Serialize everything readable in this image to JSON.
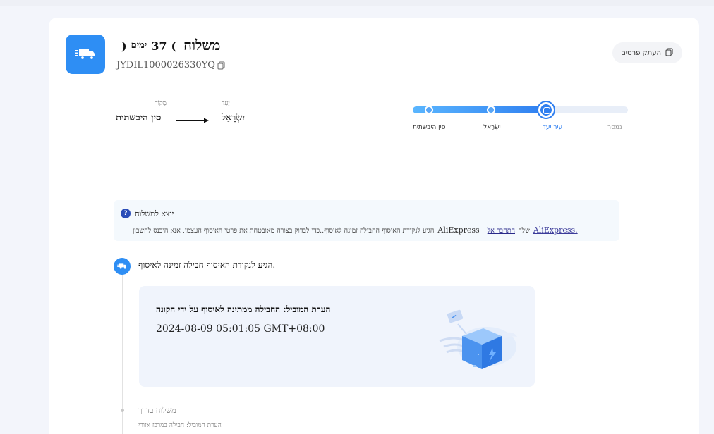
{
  "header": {
    "title": "משלוח",
    "days_number": "37",
    "days_word": "ימים",
    "open_paren": "(",
    "close_paren": ")",
    "tracking_number": "JYDIL1000026330YQ",
    "copy_details_label": "העתק פרטים",
    "icons": {
      "main": "truck-icon",
      "copy": "copy-icon",
      "copy_small": "copy-icon"
    }
  },
  "route": {
    "origin_label": "מָקוֹר",
    "origin_value": "סין היבשתית",
    "destination_label": "יַעַד",
    "destination_value": "יִשְׂרָאֵל"
  },
  "progress": {
    "fraction_filled": 0.62,
    "stages": [
      {
        "label": "סין היבשתית",
        "status": "done"
      },
      {
        "label": "יִשְׂרָאֵל",
        "status": "done"
      },
      {
        "label": "עיר יעד",
        "status": "current"
      },
      {
        "label": "נמסר",
        "status": "future"
      }
    ],
    "colors": {
      "fill_start": "#5ab6ff",
      "fill_end": "#2f7ff0",
      "track": "#e8eef8",
      "current": "#2f7ff0"
    }
  },
  "notice": {
    "title": "יוצא למשלוח",
    "body_text": "הגיע לנקודת האיסוף החבילה זמינה לאיסוף..כדי לבדוק בצורה מאובטחת את פרטי האיסוף העצמי, אנא היכנס לחשבון",
    "brand": "AliExpress",
    "link_connect": "התחבר אל",
    "your_word": "שלך",
    "link_site": " AliExpress."
  },
  "timeline": {
    "current_event": {
      "title": "הגיע לנקודת האיסוף חבילה זמינה לאיסוף.",
      "carrier_note": "הערת המוביל: החבילה ממתינה לאיסוף על ידי הקונה",
      "timestamp": "2024-08-09 05:01:05 GMT+08:00"
    },
    "next_event": {
      "title": "משלוח בדרך",
      "carrier_note": "הערת המוביל: חבילה במרכז אזורי"
    }
  },
  "colors": {
    "accent": "#2e8ef4",
    "page_bg": "#f3f5fb",
    "card_bg": "#ffffff",
    "event_card_bg": "#f0f4fc"
  }
}
